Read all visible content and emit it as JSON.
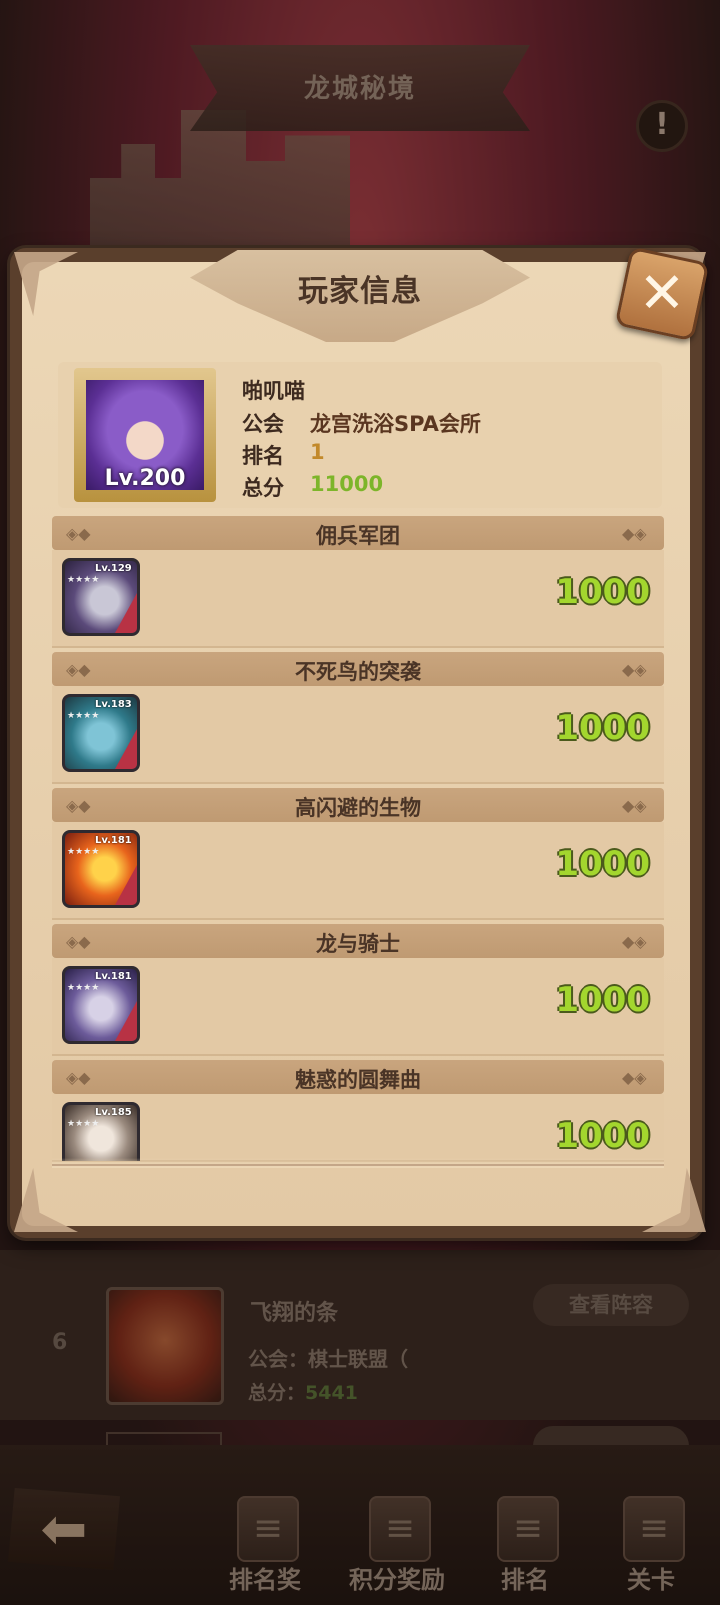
{
  "top_bar": {
    "title": "龙城秘境",
    "info_icon": "exclamation-icon"
  },
  "modal": {
    "title": "玩家信息",
    "close_icon": "close-icon",
    "player": {
      "name": "啪叽喵",
      "level_label": "Lv.200",
      "guild_label": "公会",
      "guild_value": "龙宫洗浴SPA会所",
      "rank_label": "排名",
      "rank_value": "1",
      "score_label": "总分",
      "score_value": "11000"
    },
    "stages": [
      {
        "title": "佣兵军团",
        "hero_level": "Lv.129",
        "score": "1000"
      },
      {
        "title": "不死鸟的突袭",
        "hero_level": "Lv.183",
        "score": "1000"
      },
      {
        "title": "高闪避的生物",
        "hero_level": "Lv.181",
        "score": "1000"
      },
      {
        "title": "龙与骑士",
        "hero_level": "Lv.181",
        "score": "1000"
      },
      {
        "title": "魅惑的圆舞曲",
        "hero_level": "Lv.185",
        "score": "1000"
      }
    ]
  },
  "background_list": {
    "row": {
      "rank": "6",
      "name": "飞翔的条",
      "guild": "公会：棋士联盟（",
      "score_label": "总分：",
      "score_value": "5441",
      "view_button": "查看阵容"
    }
  },
  "bottom_nav": {
    "back_icon": "back-arrow-icon",
    "items": [
      {
        "label": "排名奖",
        "icon": "rank-reward-icon"
      },
      {
        "label": "积分奖励",
        "icon": "points-reward-icon"
      },
      {
        "label": "排名",
        "icon": "ranking-icon"
      },
      {
        "label": "关卡",
        "icon": "stage-icon"
      }
    ]
  },
  "colors": {
    "score_green": "#a3d62e",
    "rank_orange": "#c2892a",
    "panel_bg": "#ecd7b6",
    "frame_brown": "#5a3f2c"
  }
}
